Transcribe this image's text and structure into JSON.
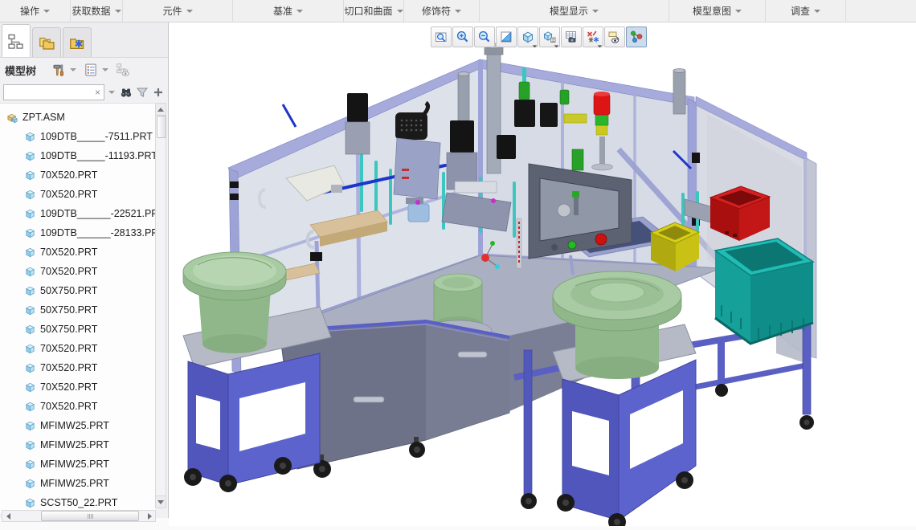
{
  "menubar": {
    "items": [
      {
        "label": "操作"
      },
      {
        "label": "获取数据"
      },
      {
        "label": "元件"
      },
      {
        "label": "基准"
      },
      {
        "label": "切口和曲面"
      },
      {
        "label": "修饰符"
      },
      {
        "label": "模型显示"
      },
      {
        "label": "模型意图"
      },
      {
        "label": "调查"
      }
    ]
  },
  "toolbar": {
    "buttons": [
      {
        "icon": "refit-icon",
        "pressed": false,
        "dropdown": false
      },
      {
        "icon": "zoom-in-icon",
        "pressed": false,
        "dropdown": false
      },
      {
        "icon": "zoom-out-icon",
        "pressed": false,
        "dropdown": false
      },
      {
        "icon": "repaint-icon",
        "pressed": false,
        "dropdown": false
      },
      {
        "icon": "shaded-display-icon",
        "pressed": false,
        "dropdown": true
      },
      {
        "icon": "display-style-icon",
        "pressed": false,
        "dropdown": true
      },
      {
        "icon": "saved-views-icon",
        "pressed": false,
        "dropdown": false
      },
      {
        "icon": "datum-display-icon",
        "pressed": false,
        "dropdown": true
      },
      {
        "icon": "annotation-display-icon",
        "pressed": false,
        "dropdown": false
      },
      {
        "icon": "spin-center-icon",
        "pressed": true,
        "dropdown": false
      }
    ]
  },
  "panel": {
    "title": "模型树",
    "tabs": [
      {
        "icon": "model-tree-tab-icon",
        "active": true
      },
      {
        "icon": "folder-browser-tab-icon",
        "active": false
      },
      {
        "icon": "favorites-tab-icon",
        "active": false
      }
    ],
    "search": {
      "value": "",
      "placeholder": "",
      "clear_label": "×"
    }
  },
  "tree": {
    "items": [
      {
        "label": "ZPT.ASM",
        "type": "asm",
        "level": 0
      },
      {
        "label": "109DTB_____-7511.PRT",
        "type": "part",
        "level": 1
      },
      {
        "label": "109DTB_____-11193.PRT",
        "type": "part",
        "level": 1
      },
      {
        "label": "70X520.PRT",
        "type": "part",
        "level": 1
      },
      {
        "label": "70X520.PRT",
        "type": "part",
        "level": 1
      },
      {
        "label": "109DTB______-22521.PR",
        "type": "part",
        "level": 1
      },
      {
        "label": "109DTB______-28133.PR",
        "type": "part",
        "level": 1
      },
      {
        "label": "70X520.PRT",
        "type": "part",
        "level": 1
      },
      {
        "label": "70X520.PRT",
        "type": "part",
        "level": 1
      },
      {
        "label": "50X750.PRT",
        "type": "part",
        "level": 1
      },
      {
        "label": "50X750.PRT",
        "type": "part",
        "level": 1
      },
      {
        "label": "50X750.PRT",
        "type": "part",
        "level": 1
      },
      {
        "label": "70X520.PRT",
        "type": "part",
        "level": 1
      },
      {
        "label": "70X520.PRT",
        "type": "part",
        "level": 1
      },
      {
        "label": "70X520.PRT",
        "type": "part",
        "level": 1
      },
      {
        "label": "70X520.PRT",
        "type": "part",
        "level": 1
      },
      {
        "label": "MFIMW25.PRT",
        "type": "part",
        "level": 1
      },
      {
        "label": "MFIMW25.PRT",
        "type": "part",
        "level": 1
      },
      {
        "label": "MFIMW25.PRT",
        "type": "part",
        "level": 1
      },
      {
        "label": "MFIMW25.PRT",
        "type": "part",
        "level": 1
      },
      {
        "label": "SCST50_22.PRT",
        "type": "part",
        "level": 1
      }
    ]
  },
  "scene": {
    "description": "3D shaded view of ZPT.ASM automated assembly machine: aluminum-framed glass enclosure on gray cabinet, two green vibratory bowl feeders on blue carts, red/yellow part bins, teal tote on stand, red-green signal tower, black motors and steel pillars",
    "colors": {
      "frame_lavender": "#9da3d6",
      "frame_lavender_light": "#a8addd",
      "glass_panel": "rgba(174,183,205,0.42)",
      "deck_gray": "#aab0c2",
      "cabinet_gray": "#6e7288",
      "cabinet_gray_light": "#787d93",
      "door_gray": "rgba(190,195,208,0.6)",
      "cart_blue": "#5056bc",
      "cart_blue_light": "#5d63cc",
      "bowl_green_top": "#a9cba4",
      "bowl_green_side": "#8fb78a",
      "bin_red": "#c31616",
      "bin_yellow": "#c9c214",
      "tote_teal": "#16a09a",
      "signal_red": "#dd1515",
      "signal_green": "#2ab52a",
      "signal_yellow": "#c9c920",
      "motor_black": "#161616",
      "pillar_steel": "#9ba1ae",
      "rod_teal": "#3bc7c0",
      "rod_blue": "#1d35c8",
      "triad_red": "#e23030",
      "triad_green": "#22bb22",
      "triad_cyan": "#30d0e0"
    }
  }
}
